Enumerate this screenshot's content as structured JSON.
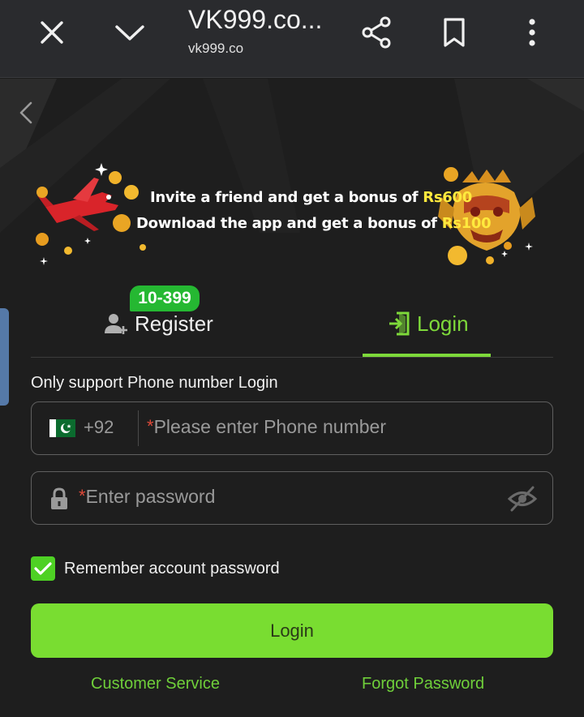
{
  "browser": {
    "title": "VK999.co...",
    "url": "vk999.co",
    "icons": [
      "close-icon",
      "chevron-down-icon",
      "share-icon",
      "bookmark-icon",
      "more-vert-icon"
    ]
  },
  "banner": {
    "line1_prefix": "Invite a friend and get a bonus of ",
    "line1_amount": "Rs600",
    "line2_prefix": "Download the app and get a bonus of ",
    "line2_amount": "Rs100"
  },
  "tabs": {
    "register_label": "Register",
    "register_badge": "10-399",
    "login_label": "Login",
    "active": "login"
  },
  "form": {
    "support_note": "Only support Phone number Login",
    "country_code": "+92",
    "required_mark": "*",
    "phone_placeholder": "Please enter Phone number",
    "password_placeholder": "Enter password",
    "remember_label": "Remember account password",
    "remember_checked": true,
    "login_button": "Login"
  },
  "links": {
    "customer_service": "Customer Service",
    "forgot_password": "Forgot Password"
  },
  "colors": {
    "accent": "#7ed93a",
    "badge": "#25b832",
    "button": "#79dd31",
    "required": "#e04a3a",
    "banner_amount": "#ffe93d"
  }
}
